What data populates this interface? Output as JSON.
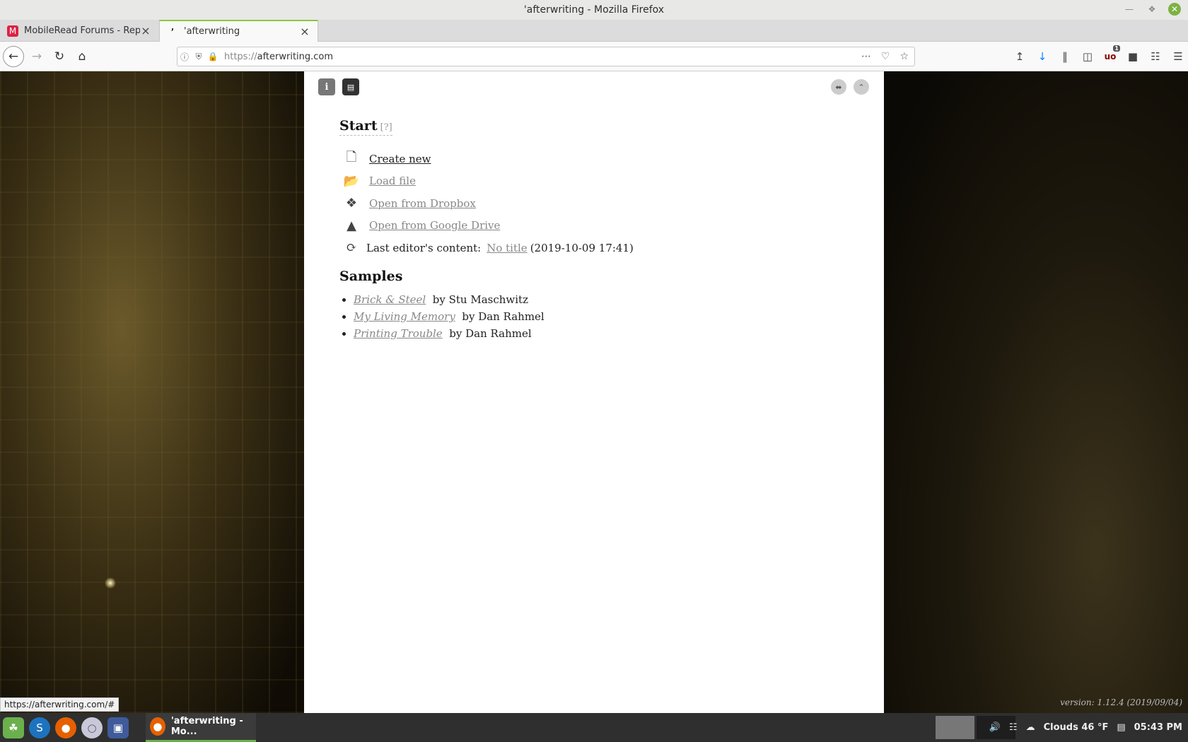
{
  "window": {
    "title": "'afterwriting - Mozilla Firefox"
  },
  "tabs": [
    {
      "title": "MobileRead Forums - Reply to",
      "favicon": "mobileread-icon"
    },
    {
      "title": "'afterwriting",
      "favicon": "afterwriting-icon"
    }
  ],
  "url": {
    "protocol": "https://",
    "host": "afterwriting.com"
  },
  "app": {
    "info_label": "i",
    "start": {
      "title": "Start",
      "help": "[?]"
    },
    "actions": {
      "create": "Create new",
      "load": "Load file",
      "dropbox": "Open from Dropbox",
      "gdrive": "Open from Google Drive",
      "last_label": "Last editor's content:",
      "last_link": "No title",
      "last_date": "(2019-10-09 17:41)"
    },
    "samples": {
      "title": "Samples",
      "items": [
        {
          "title": "Brick & Steel",
          "author": "by Stu Maschwitz"
        },
        {
          "title": "My Living Memory",
          "author": "by Dan Rahmel"
        },
        {
          "title": "Printing Trouble",
          "author": "by Dan Rahmel"
        }
      ]
    },
    "version": "version: 1.12.4 (2019/09/04)"
  },
  "status_url": "https://afterwriting.com/#",
  "toolbar": {
    "badge": "1"
  },
  "taskbar": {
    "task_title": "'afterwriting - Mo...",
    "weather": "Clouds 46 °F",
    "clock": "05:43 PM"
  },
  "colors": {
    "accent": "#8dc63f",
    "link": "#888888"
  }
}
